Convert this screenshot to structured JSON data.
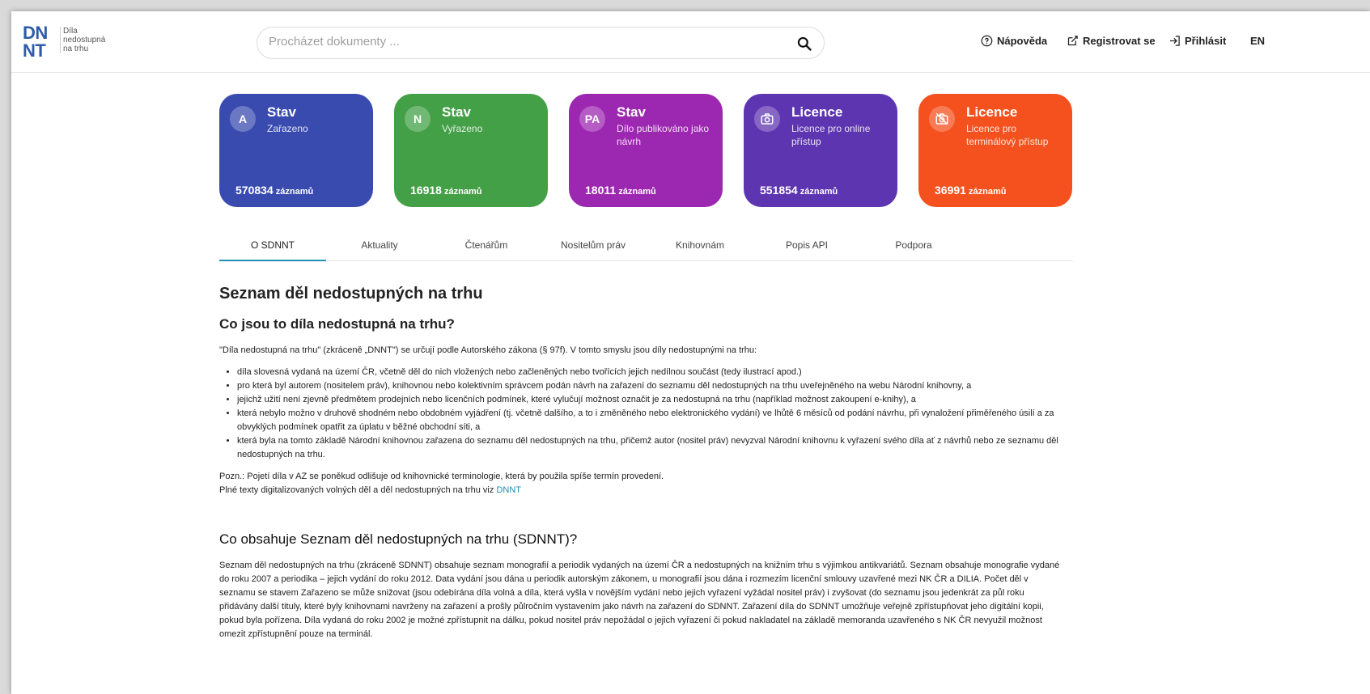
{
  "header": {
    "logo_top": "DN",
    "logo_bottom": "NT",
    "logo_sub_1": "Díla",
    "logo_sub_2": "nedostupná",
    "logo_sub_3": "na trhu",
    "search_placeholder": "Procházet dokumenty ...",
    "nav": {
      "help": "Nápověda",
      "register": "Registrovat se",
      "login": "Přihlásit",
      "lang": "EN"
    }
  },
  "cards": [
    {
      "badge": "A",
      "title": "Stav",
      "subtitle": "Zařazeno",
      "count": "570834",
      "count_label": "záznamů",
      "color": "#3a4bb0"
    },
    {
      "badge": "N",
      "title": "Stav",
      "subtitle": "Vyřazeno",
      "count": "16918",
      "count_label": "záznamů",
      "color": "#43a047"
    },
    {
      "badge": "PA",
      "title": "Stav",
      "subtitle": "Dílo publikováno jako návrh",
      "count": "18011",
      "count_label": "záznamů",
      "color": "#9c27b0"
    },
    {
      "badge_icon": "camera-icon",
      "title": "Licence",
      "subtitle": "Licence pro online přístup",
      "count": "551854",
      "count_label": "záznamů",
      "color": "#5e35b1"
    },
    {
      "badge_icon": "camera-off-icon",
      "title": "Licence",
      "subtitle": "Licence pro terminálový přístup",
      "count": "36991",
      "count_label": "záznamů",
      "color": "#f4511e"
    }
  ],
  "tabs": [
    "O SDNNT",
    "Aktuality",
    "Čtenářům",
    "Nositelům práv",
    "Knihovnám",
    "Popis API",
    "Podpora"
  ],
  "content": {
    "h1": "Seznam děl nedostupných na trhu",
    "h2_1": "Co jsou to díla nedostupná na trhu?",
    "intro": "\"Díla nedostupná na trhu\" (zkráceně „DNNT\") se určují podle Autorského zákona (§ 97f). V tomto smyslu jsou díly nedostupnými na trhu:",
    "bullets": [
      "díla slovesná vydaná na území ČR, včetně děl do nich vložených nebo začleněných nebo tvořících jejich nedílnou součást (tedy ilustrací apod.)",
      "pro která byl autorem (nositelem práv), knihovnou nebo kolektivním správcem podán návrh na zařazení do seznamu děl nedostupných na trhu uveřejněného na webu Národní knihovny, a",
      "jejichž užití není zjevně předmětem prodejních nebo licenčních podmínek, které vylučují možnost označit je za nedostupná na trhu (například možnost zakoupení e-knihy), a",
      "která nebylo možno v druhově shodném nebo obdobném vyjádření (tj. včetně dalšího, a to i změněného nebo elektronického vydání) ve lhůtě 6 měsíců od podání návrhu, při vynaložení přiměřeného úsilí a za obvyklých podmínek opatřit za úplatu v běžné obchodní síti, a",
      "která byla na tomto základě Národní knihovnou zařazena do seznamu děl nedostupných na trhu, přičemž autor (nositel práv) nevyzval Národní knihovnu k vyřazení svého díla ať z návrhů nebo ze seznamu děl nedostupných na trhu."
    ],
    "note": "Pozn.: Pojetí díla v AZ se poněkud odlišuje od knihovnické terminologie, která by použila spíše termín provedení.",
    "fulltext_prefix": "Plné texty digitalizovaných volných děl a děl nedostupných na trhu viz ",
    "fulltext_link": "DNNT",
    "h2_2": "Co obsahuje Seznam děl nedostupných na trhu (SDNNT)?",
    "para2": "Seznam děl nedostupných na trhu (zkráceně SDNNT) obsahuje seznam monografií a periodik vydaných na území ČR a nedostupných na knižním trhu s výjimkou antikvariátů. Seznam obsahuje monografie vydané do roku 2007 a periodika – jejich vydání do roku 2012. Data vydání jsou dána u periodik autorským zákonem, u monografií jsou dána i rozmezím licenční smlouvy uzavřené mezi NK ČR a DILIA. Počet děl v seznamu se stavem Zařazeno se může snižovat (jsou odebírána díla volná a díla, která vyšla v novějším vydání nebo jejich vyřazení vyžádal nositel práv) i zvyšovat (do seznamu jsou jedenkrát za půl roku přidávány další tituly, které byly knihovnami navrženy na zařazení a prošly půlročním vystavením jako návrh na zařazení do SDNNT. Zařazení díla do SDNNT umožňuje veřejně zpřístupňovat jeho digitální kopii, pokud byla pořízena. Díla vydaná do roku 2002 je možné zpřístupnit na dálku, pokud nositel práv nepožádal o jejich vyřazení či pokud nakladatel na základě memoranda uzavřeného s NK ČR nevyužil možnost omezit zpřístupnění pouze na terminál."
  }
}
